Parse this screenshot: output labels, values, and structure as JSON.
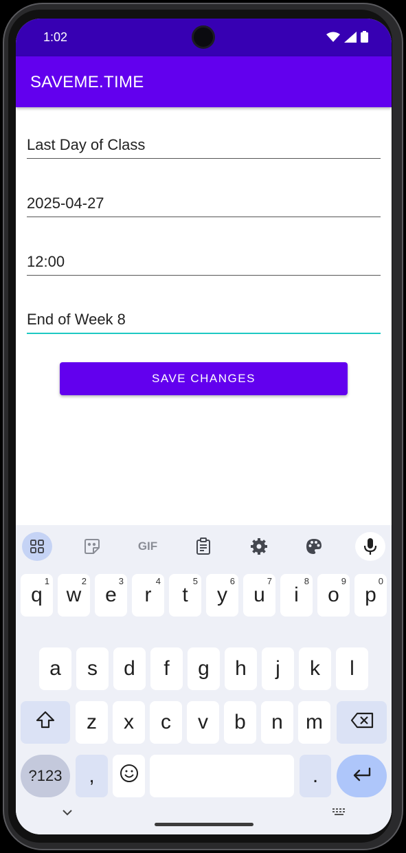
{
  "status_bar": {
    "time": "1:02"
  },
  "app_bar": {
    "title": "SAVEME.TIME"
  },
  "form": {
    "title_value": "Last Day of Class",
    "date_value": "2025-04-27",
    "time_value": "12:00",
    "note_value": "End of Week 8",
    "save_label": "SAVE CHANGES"
  },
  "keyboard": {
    "toolbar": {
      "gif_label": "GIF"
    },
    "row1": [
      {
        "key": "q",
        "hint": "1"
      },
      {
        "key": "w",
        "hint": "2"
      },
      {
        "key": "e",
        "hint": "3"
      },
      {
        "key": "r",
        "hint": "4"
      },
      {
        "key": "t",
        "hint": "5"
      },
      {
        "key": "y",
        "hint": "6"
      },
      {
        "key": "u",
        "hint": "7"
      },
      {
        "key": "i",
        "hint": "8"
      },
      {
        "key": "o",
        "hint": "9"
      },
      {
        "key": "p",
        "hint": "0"
      }
    ],
    "row2": [
      "a",
      "s",
      "d",
      "f",
      "g",
      "h",
      "j",
      "k",
      "l"
    ],
    "row3": [
      "z",
      "x",
      "c",
      "v",
      "b",
      "n",
      "m"
    ],
    "symbols_label": "?123",
    "comma_label": ",",
    "period_label": "."
  },
  "colors": {
    "status_bar": "#3700b3",
    "primary": "#6200ee",
    "focus_underline": "#1ec9c3",
    "keyboard_bg": "#eef0f7"
  },
  "icons": [
    "wifi-icon",
    "signal-icon",
    "battery-icon",
    "apps-grid-icon",
    "sticker-icon",
    "clipboard-icon",
    "settings-icon",
    "palette-icon",
    "mic-icon",
    "shift-icon",
    "backspace-icon",
    "emoji-icon",
    "enter-icon",
    "hide-keyboard-icon",
    "keyboard-switch-icon"
  ]
}
